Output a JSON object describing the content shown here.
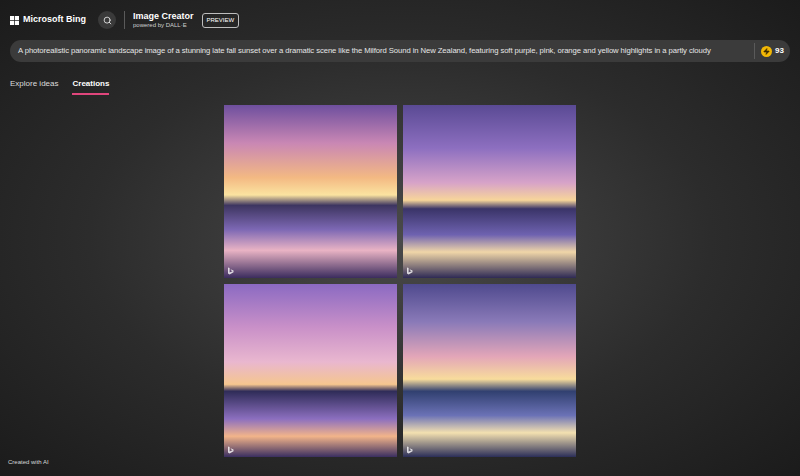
{
  "header": {
    "brand": "Microsoft Bing",
    "product": "Image Creator",
    "powered_by": "powered by DALL·E",
    "badge": "PREVIEW"
  },
  "prompt": {
    "value": "A photorealistic panoramic landscape image of a stunning late fall sunset over a dramatic scene like the Milford Sound in New Zealand, featuring soft purple, pink, orange and yellow highlights in a partly cloudy",
    "coins": "93"
  },
  "tabs": [
    {
      "label": "Explore ideas",
      "selected": false
    },
    {
      "label": "Creations",
      "selected": true
    }
  ],
  "footer": {
    "note": "Created with AI"
  }
}
